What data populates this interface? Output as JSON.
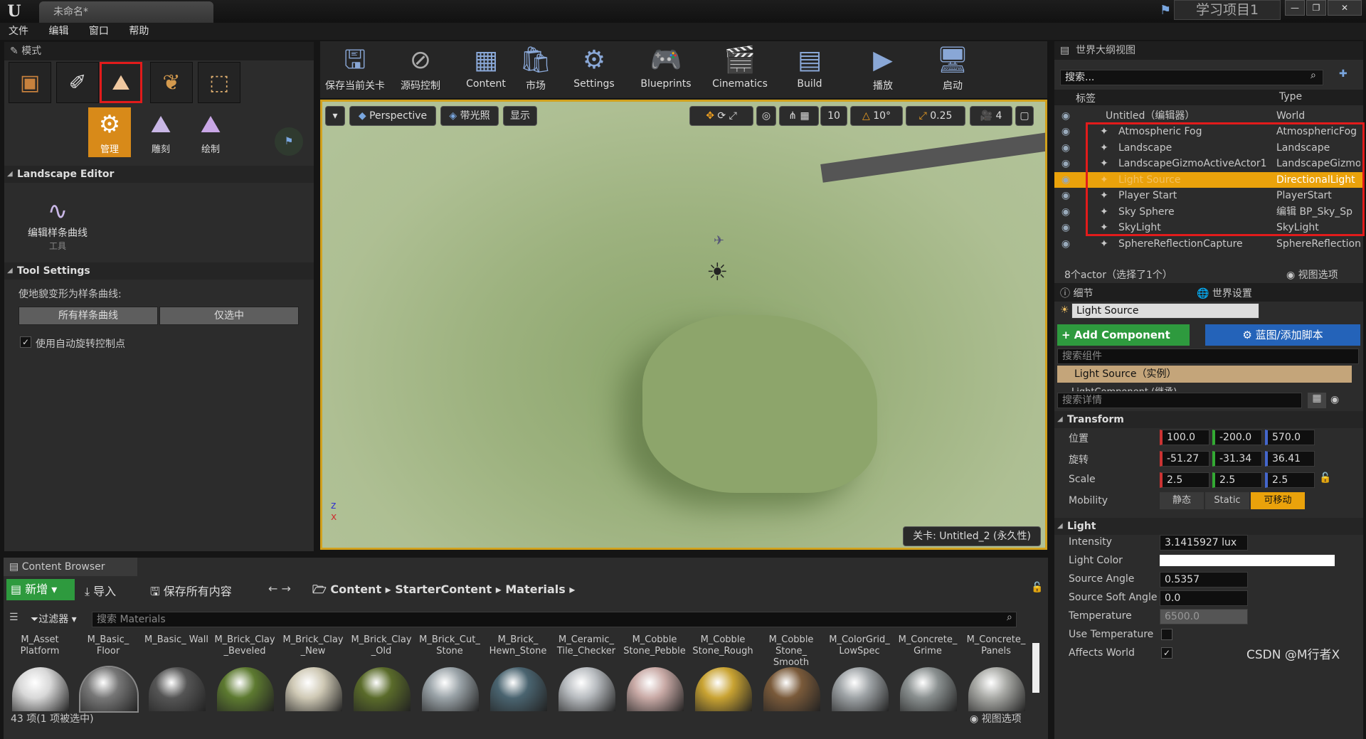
{
  "window": {
    "doc_tab": "未命名*",
    "project": "学习项目1"
  },
  "menu": [
    "文件",
    "编辑",
    "窗口",
    "帮助"
  ],
  "modes": {
    "tab": "模式",
    "subtools": [
      "管理",
      "雕刻",
      "绘制"
    ]
  },
  "landscape": {
    "header": "Landscape Editor",
    "tool_label": "编辑样条曲线",
    "tool_sub": "工具"
  },
  "tool_settings": {
    "header": "Tool Settings",
    "desc": "使地貌变形为样条曲线:",
    "btn_all": "所有样条曲线",
    "btn_selected": "仅选中",
    "auto_rotate": "使用自动旋转控制点"
  },
  "toolbar": [
    "保存当前关卡",
    "源码控制",
    "Content",
    "市场",
    "Settings",
    "Blueprints",
    "Cinematics",
    "Build",
    "播放",
    "启动"
  ],
  "viewport": {
    "perspective": "Perspective",
    "lit": "带光照",
    "show": "显示",
    "grid": "10",
    "angle": "10°",
    "scale": "0.25",
    "speed": "4",
    "level_label": "关卡: Untitled_2 (永久性)"
  },
  "outliner": {
    "tab": "世界大纲视图",
    "search": "搜索...",
    "col_label": "标签",
    "col_type": "Type",
    "root": {
      "name": "Untitled（编辑器）",
      "type": "World"
    },
    "rows": [
      {
        "name": "Atmospheric Fog",
        "type": "AtmosphericFog"
      },
      {
        "name": "Landscape",
        "type": "Landscape"
      },
      {
        "name": "LandscapeGizmoActiveActor1",
        "type": "LandscapeGizmo"
      },
      {
        "name": "Light Source",
        "type": "DirectionalLight"
      },
      {
        "name": "Player Start",
        "type": "PlayerStart"
      },
      {
        "name": "Sky Sphere",
        "type": "编辑 BP_Sky_Sp"
      },
      {
        "name": "SkyLight",
        "type": "SkyLight"
      },
      {
        "name": "SphereReflectionCapture",
        "type": "SphereReflection"
      }
    ],
    "footer": "8个actor（选择了1个）",
    "view_options": "视图选项"
  },
  "details": {
    "tab1": "细节",
    "tab2": "世界设置",
    "name": "Light Source",
    "add_component": "+ Add Component",
    "blueprint": "蓝图/添加脚本",
    "search_comp": "搜索组件",
    "instance": "Light Source（实例）",
    "component": "LightComponent (继承)",
    "search_details": "搜索详情",
    "transform": {
      "header": "Transform",
      "loc_label": "位置",
      "rot_label": "旋转",
      "scale_label": "Scale",
      "loc": [
        "100.0",
        "-200.0",
        "570.0"
      ],
      "rot": [
        "-51.27",
        "-31.34",
        "36.41"
      ],
      "scale": [
        "2.5",
        "2.5",
        "2.5"
      ],
      "mobility_label": "Mobility",
      "mob_static": "静态",
      "mob_stationary": "Static",
      "mob_movable": "可移动"
    },
    "light": {
      "header": "Light",
      "intensity_label": "Intensity",
      "intensity": "3.1415927 lux",
      "color_label": "Light Color",
      "angle_label": "Source Angle",
      "angle": "0.5357",
      "soft_label": "Source Soft Angle",
      "soft": "0.0",
      "temp_label": "Temperature",
      "temp": "6500.0",
      "use_temp_label": "Use Temperature",
      "affects_label": "Affects World"
    }
  },
  "content_browser": {
    "tab": "Content Browser",
    "new": "新增",
    "import": "导入",
    "save_all": "保存所有内容",
    "path": [
      "Content",
      "StarterContent",
      "Materials"
    ],
    "filter": "过滤器",
    "search": "搜索 Materials",
    "assets": [
      "M_Asset Platform",
      "M_Basic_ Floor",
      "M_Basic_ Wall",
      "M_Brick_Clay _Beveled",
      "M_Brick_Clay _New",
      "M_Brick_Clay _Old",
      "M_Brick_Cut_ Stone",
      "M_Brick_ Hewn_Stone",
      "M_Ceramic_ Tile_Checker",
      "M_Cobble Stone_Pebble",
      "M_Cobble Stone_Rough",
      "M_Cobble Stone_ Smooth",
      "M_ColorGrid_ LowSpec",
      "M_Concrete_ Grime",
      "M_Concrete_ Panels"
    ],
    "colors": [
      "#d8d8d8",
      "#777",
      "#555",
      "#5d7a30",
      "#cfc9b5",
      "#5a6b2a",
      "#9aa3a8",
      "#4a6470",
      "#b8bcc0",
      "#c9aaa6",
      "#c9a332",
      "#7a5a3a",
      "#9ea3a6",
      "#8a9090",
      "#a9aaa6"
    ],
    "status": "43 项(1 项被选中)",
    "view_options": "视图选项"
  },
  "watermark": "CSDN @M行者X"
}
